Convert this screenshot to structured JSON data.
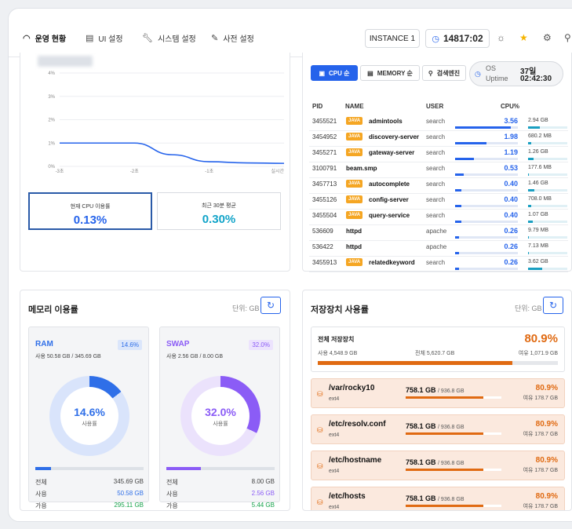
{
  "nav": {
    "tabs": [
      {
        "label": "운영 현황",
        "icon": "gauge-icon"
      },
      {
        "label": "UI 설정",
        "icon": "layout-icon"
      },
      {
        "label": "시스템 설정",
        "icon": "wrench-icon"
      },
      {
        "label": "사전 설정",
        "icon": "edit-icon"
      }
    ],
    "instance": "INSTANCE 1",
    "time": "14817:02",
    "accent": "#2563eb"
  },
  "cpu": {
    "chart_data": {
      "type": "line",
      "x": [
        "-3초",
        "-2초",
        "-1초",
        "실시간"
      ],
      "series": [
        {
          "values": [
            1.0,
            1.0,
            1.0,
            0.5,
            0.2,
            0.15,
            0.13
          ]
        }
      ],
      "ylim": [
        0,
        4
      ],
      "yticks": [
        "0%",
        "1%",
        "2%",
        "3%",
        "4%"
      ],
      "grid": true
    },
    "current_label": "현재 CPU 이용률",
    "current_value": "0.13%",
    "avg_label": "최근 30분 평균",
    "avg_value": "0.30%"
  },
  "process": {
    "sort_cpu": "CPU 순",
    "sort_memory": "MEMORY 순",
    "sort_search": "검색엔진",
    "uptime_label_1": "OS",
    "uptime_label_2": "Uptime",
    "uptime_days": "37일",
    "uptime_time": "02:42:30",
    "headers": {
      "pid": "PID",
      "name": "NAME",
      "user": "USER",
      "cpu": "CPU%"
    },
    "rows": [
      {
        "pid": "3455521",
        "java": true,
        "name": "admintools",
        "user": "search",
        "cpu": "3.56",
        "mem": "2.94 GB",
        "cpu_pct": 3.56,
        "mem_pct": 0.3
      },
      {
        "pid": "3454952",
        "java": true,
        "name": "discovery-server",
        "user": "search",
        "cpu": "1.98",
        "mem": "680.2 MB",
        "cpu_pct": 1.98,
        "mem_pct": 0.07
      },
      {
        "pid": "3455271",
        "java": true,
        "name": "gateway-server",
        "user": "search",
        "cpu": "1.19",
        "mem": "1.26 GB",
        "cpu_pct": 1.19,
        "mem_pct": 0.13
      },
      {
        "pid": "3100791",
        "java": false,
        "name": "beam.smp",
        "user": "search",
        "cpu": "0.53",
        "mem": "177.6 MB",
        "cpu_pct": 0.53,
        "mem_pct": 0.02
      },
      {
        "pid": "3457713",
        "java": true,
        "name": "autocomplete",
        "user": "search",
        "cpu": "0.40",
        "mem": "1.46 GB",
        "cpu_pct": 0.4,
        "mem_pct": 0.15
      },
      {
        "pid": "3455126",
        "java": true,
        "name": "config-server",
        "user": "search",
        "cpu": "0.40",
        "mem": "708.0 MB",
        "cpu_pct": 0.4,
        "mem_pct": 0.07
      },
      {
        "pid": "3455504",
        "java": true,
        "name": "query-service",
        "user": "search",
        "cpu": "0.40",
        "mem": "1.07 GB",
        "cpu_pct": 0.4,
        "mem_pct": 0.11
      },
      {
        "pid": "536609",
        "java": false,
        "name": "httpd",
        "user": "apache",
        "cpu": "0.26",
        "mem": "9.79 MB",
        "cpu_pct": 0.26,
        "mem_pct": 0.01
      },
      {
        "pid": "536422",
        "java": false,
        "name": "httpd",
        "user": "apache",
        "cpu": "0.26",
        "mem": "7.13 MB",
        "cpu_pct": 0.26,
        "mem_pct": 0.01
      },
      {
        "pid": "3455913",
        "java": true,
        "name": "relatedkeyword",
        "user": "search",
        "cpu": "0.26",
        "mem": "3.62 GB",
        "cpu_pct": 0.26,
        "mem_pct": 0.36
      }
    ],
    "java_badge": "JAVA"
  },
  "memory": {
    "title": "메모리 이용률",
    "unit": "단위: GB",
    "used_label": "사용률",
    "total_label": "전체",
    "use_label": "사용",
    "avail_label": "가용",
    "ram": {
      "title": "RAM",
      "badge": "14.6%",
      "sub": "사용 50.58 GB / 345.69 GB",
      "pct": "14.6%",
      "fraction": 0.146,
      "total": "345.69 GB",
      "used": "50.58 GB",
      "avail": "295.11 GB",
      "color": "#2f6fe8"
    },
    "swap": {
      "title": "SWAP",
      "badge": "32.0%",
      "sub": "사용 2.56 GB / 8.00 GB",
      "pct": "32.0%",
      "fraction": 0.32,
      "total": "8.00 GB",
      "used": "2.56 GB",
      "avail": "5.44 GB",
      "color": "#8b5cf6"
    }
  },
  "storage": {
    "title": "저장장치 사용률",
    "unit": "단위: GB",
    "total_title": "전체 저장장치",
    "total_pct": "80.9%",
    "total_used": "사용 4,548.9 GB",
    "total_all": "전체 5,620.7 GB",
    "total_free": "여유 1,071.9 GB",
    "total_fraction": 0.809,
    "devices": [
      {
        "path": "/var/rocky10",
        "fs": "ext4",
        "used": "758.1 GB",
        "total": "/ 936.8 GB",
        "pct": "80.9%",
        "free": "여유 178.7 GB",
        "fraction": 0.809
      },
      {
        "path": "/etc/resolv.conf",
        "fs": "ext4",
        "used": "758.1 GB",
        "total": "/ 936.8 GB",
        "pct": "80.9%",
        "free": "여유 178.7 GB",
        "fraction": 0.809
      },
      {
        "path": "/etc/hostname",
        "fs": "ext4",
        "used": "758.1 GB",
        "total": "/ 936.8 GB",
        "pct": "80.9%",
        "free": "여유 178.7 GB",
        "fraction": 0.809
      },
      {
        "path": "/etc/hosts",
        "fs": "ext4",
        "used": "758.1 GB",
        "total": "/ 936.8 GB",
        "pct": "80.9%",
        "free": "여유 178.7 GB",
        "fraction": 0.809
      }
    ]
  }
}
